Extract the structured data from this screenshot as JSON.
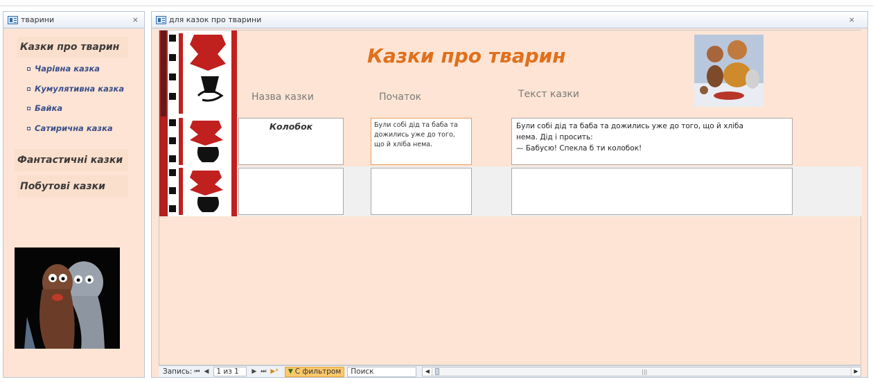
{
  "left_pane": {
    "tab_title": "тварини",
    "close_glyph": "⨯",
    "heading": "Казки про тварин",
    "items": [
      {
        "label": "Чарівна казка"
      },
      {
        "label": "Кумулятивна казка"
      },
      {
        "label": "Байка"
      },
      {
        "label": "Сатирична казка"
      }
    ],
    "section2": "Фантастичні казки",
    "section3": "Побутові казки"
  },
  "right_pane": {
    "tab_title": "для казок про тварини",
    "close_glyph": "⨯",
    "form_title": "Казки про тварин",
    "columns": {
      "name": "Назва казки",
      "beginning": "Початок",
      "text": "Текст казки"
    },
    "records": [
      {
        "name": "Колобок",
        "beginning": "Були собі дід та баба та\nдожились уже до того,\nщо й хліба нема.",
        "text": "Були собі дід та баба та дожились уже до того, що й хліба\nнема. Дід і просить:\n— Бабусю! Спекла б ти колобок!"
      },
      {
        "name": "",
        "beginning": "",
        "text": ""
      }
    ]
  },
  "navbar": {
    "label": "Запись:",
    "first": "⏮",
    "prev": "◀",
    "counter": "1 из 1",
    "next": "▶",
    "last": "⏭",
    "new": "▶*",
    "filter_label": "С фильтром",
    "search_placeholder": "Поиск",
    "scroll_left": "◀",
    "scroll_right": "▶",
    "grip": "|||"
  },
  "colors": {
    "form_background": "#fde4d4",
    "title_orange": "#e0701c",
    "nav_link_blue": "#3a4e8a",
    "filter_active": "#fcc86a"
  }
}
